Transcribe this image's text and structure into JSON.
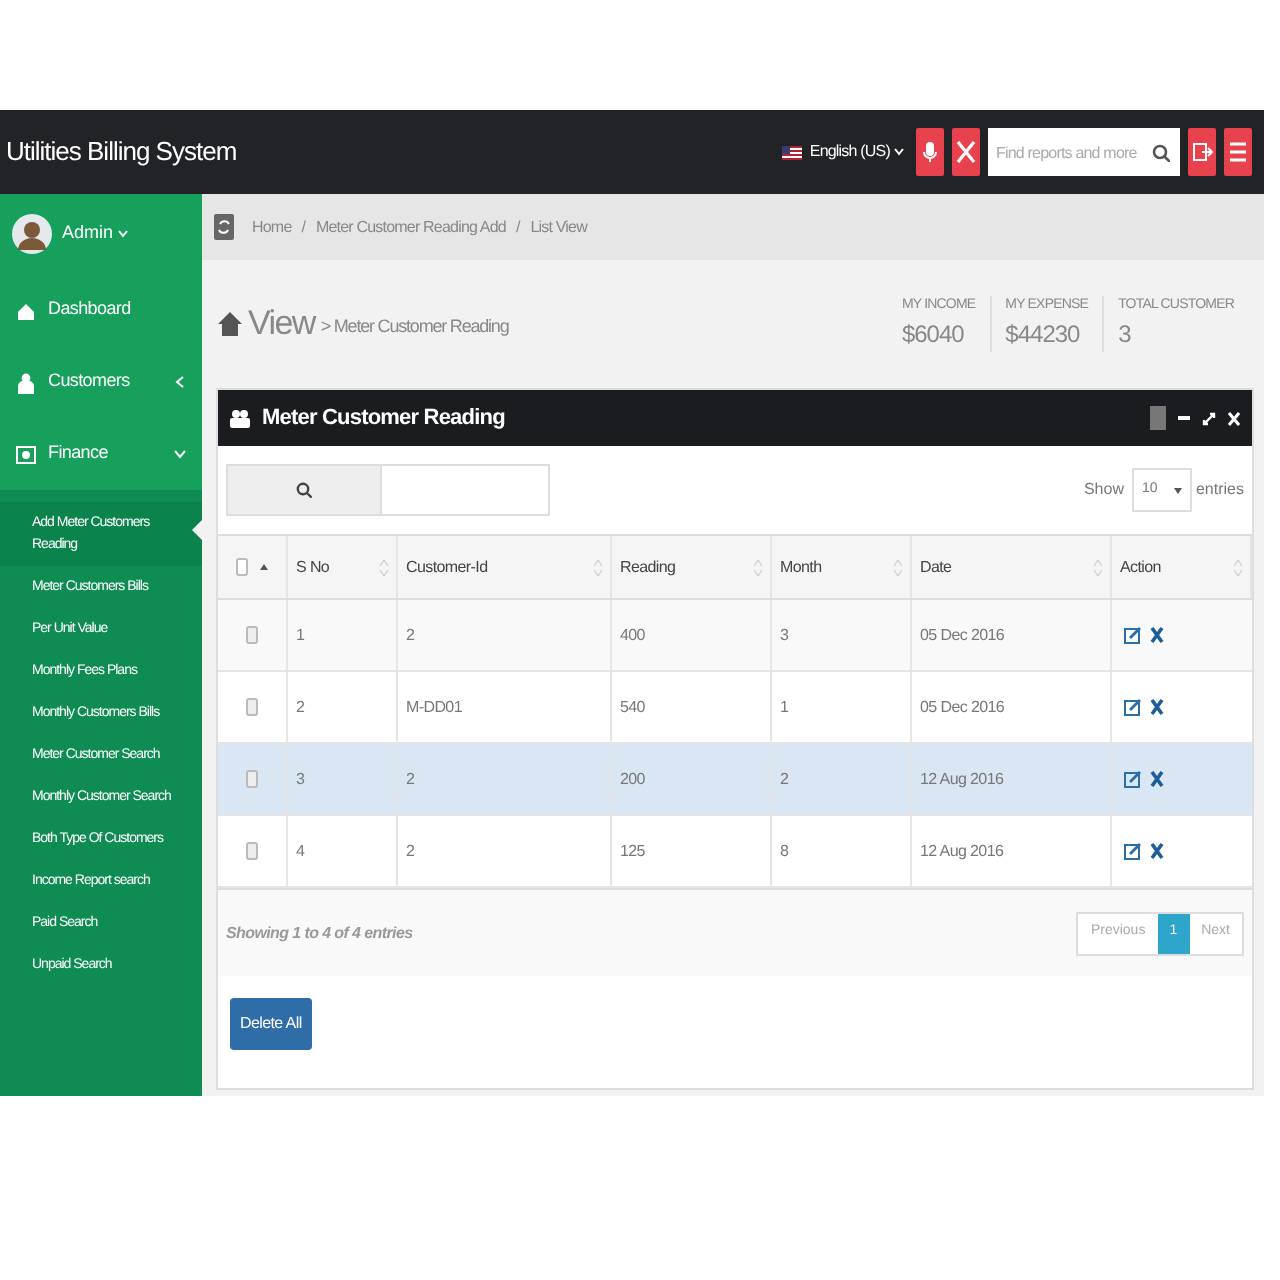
{
  "header": {
    "title": "Utilities Billing System",
    "language": "English (US)",
    "search_placeholder": "Find reports and more"
  },
  "sidebar": {
    "user": "Admin",
    "items": [
      {
        "label": "Dashboard",
        "kind": "link"
      },
      {
        "label": "Customers",
        "kind": "group",
        "expanded": false
      },
      {
        "label": "Finance",
        "kind": "group",
        "expanded": true,
        "children": [
          {
            "label": "Add Meter Customers Reading",
            "selected": true
          },
          {
            "label": "Meter Customers Bills",
            "selected": false
          },
          {
            "label": "Per Unit Value",
            "selected": false
          },
          {
            "label": "Monthly Fees Plans",
            "selected": false
          },
          {
            "label": "Monthly Customers Bills",
            "selected": false
          },
          {
            "label": "Meter Customer Search",
            "selected": false
          },
          {
            "label": "Monthly Customer Search",
            "selected": false
          },
          {
            "label": "Both Type Of Customers",
            "selected": false
          },
          {
            "label": "Income Report search",
            "selected": false
          },
          {
            "label": "Paid Search",
            "selected": false
          },
          {
            "label": "Unpaid Search",
            "selected": false
          }
        ]
      }
    ]
  },
  "breadcrumb": [
    {
      "text": "Home",
      "kind": "link"
    },
    {
      "text": "/",
      "kind": "separator"
    },
    {
      "text": "Meter Customer Reading Add",
      "kind": "link"
    },
    {
      "text": "/",
      "kind": "separator"
    },
    {
      "text": "List View",
      "kind": "link"
    }
  ],
  "page_header": {
    "title": "View",
    "subtitle": "> Meter Customer Reading"
  },
  "stats": [
    {
      "label": "MY INCOME",
      "value": "$6040"
    },
    {
      "label": "MY EXPENSE",
      "value": "$44230"
    },
    {
      "label": "TOTAL CUSTOMER",
      "value": "3"
    }
  ],
  "panel": {
    "title": "Meter Customer Reading",
    "show_label": "Show",
    "page_size": "10",
    "entries_label": "entries",
    "columns": [
      "S No",
      "Customer-Id",
      "Reading",
      "Month",
      "Date",
      "Action"
    ],
    "rows": [
      {
        "cells": [
          "1",
          "2",
          "400",
          "3",
          "05 Dec 2016"
        ],
        "checked": false,
        "highlighted": false
      },
      {
        "cells": [
          "2",
          "M-DD01",
          "540",
          "1",
          "05 Dec 2016"
        ],
        "checked": false,
        "highlighted": false
      },
      {
        "cells": [
          "3",
          "2",
          "200",
          "2",
          "12 Aug 2016"
        ],
        "checked": false,
        "highlighted": true
      },
      {
        "cells": [
          "4",
          "2",
          "125",
          "8",
          "12 Aug 2016"
        ],
        "checked": false,
        "highlighted": false
      }
    ],
    "info": "Showing 1 to 4 of 4 entries",
    "pagination": [
      {
        "label": "Previous",
        "selected": false
      },
      {
        "label": "1",
        "selected": true
      },
      {
        "label": "Next",
        "selected": false
      }
    ],
    "delete_button": "Delete All"
  }
}
